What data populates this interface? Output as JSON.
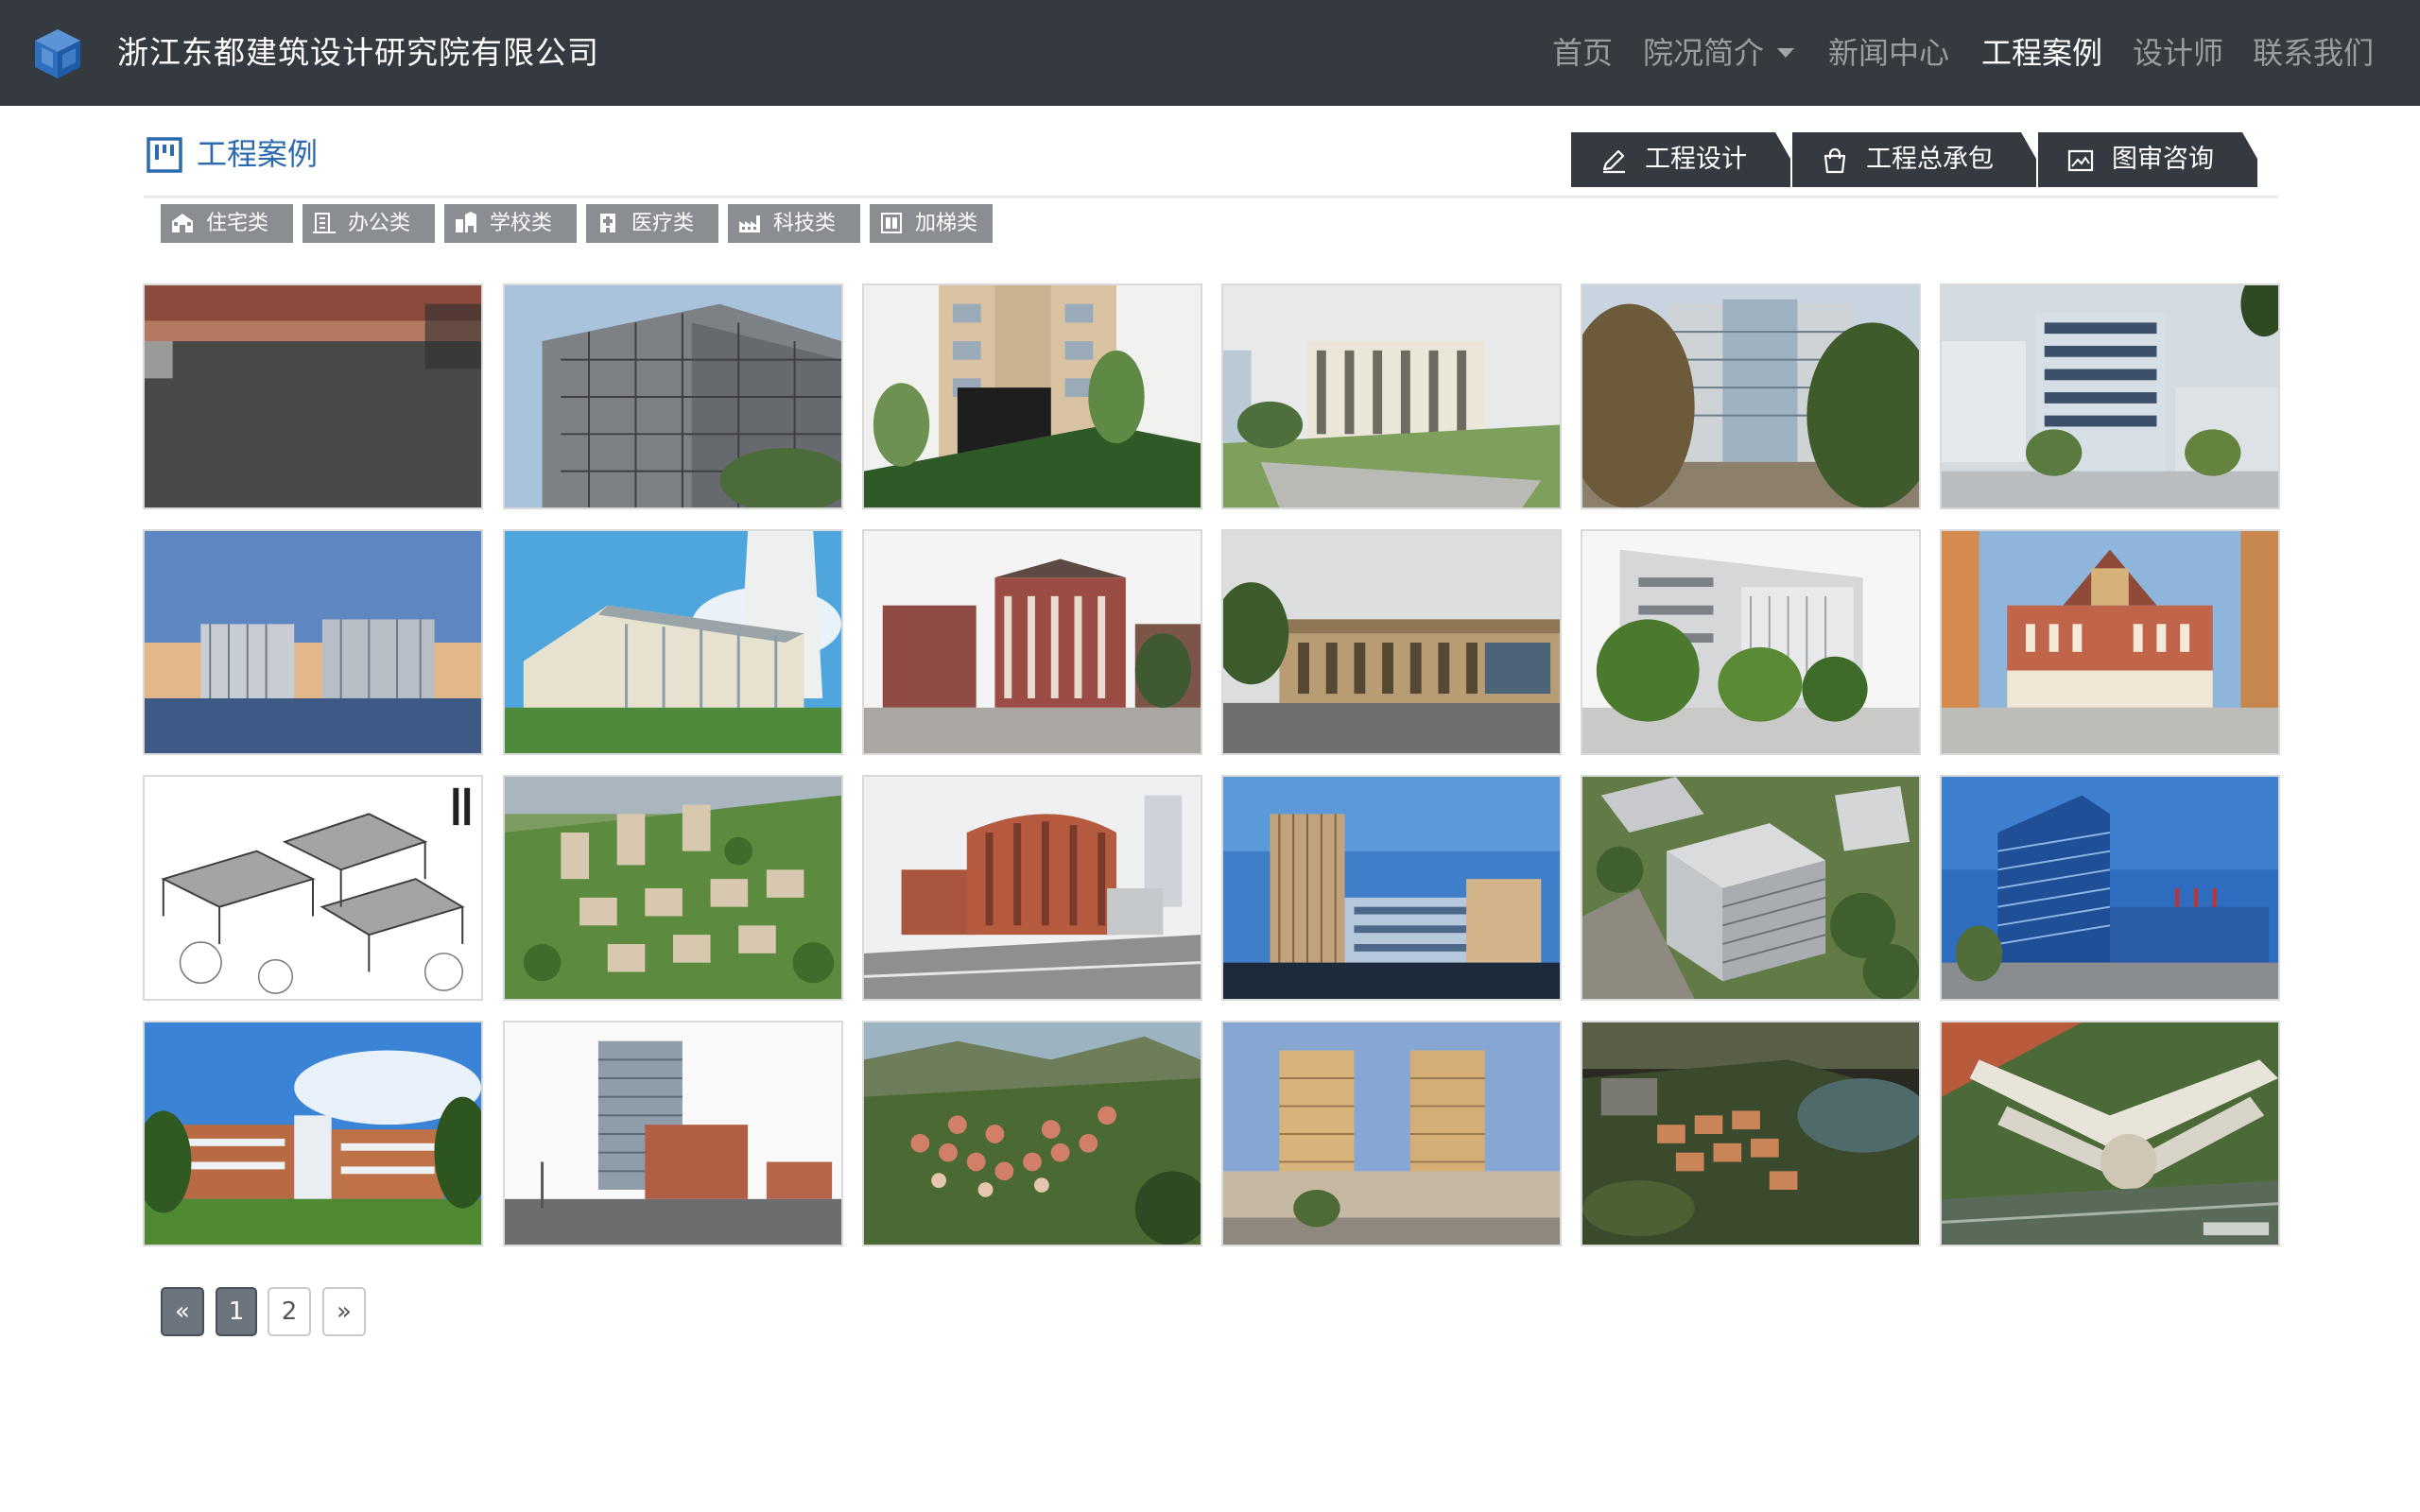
{
  "navbar": {
    "brand": "浙江东都建筑设计研究院有限公司",
    "items": [
      {
        "label": "首页",
        "active": false
      },
      {
        "label": "院况简介",
        "active": false,
        "dropdown": true
      },
      {
        "label": "新闻中心",
        "active": false
      },
      {
        "label": "工程案例",
        "active": true
      },
      {
        "label": "设计师",
        "active": false
      },
      {
        "label": "联系我们",
        "active": false
      }
    ]
  },
  "section": {
    "title": "工程案例"
  },
  "service_tabs": [
    {
      "label": "工程设计",
      "icon": "pencil-icon"
    },
    {
      "label": "工程总承包",
      "icon": "bag-icon"
    },
    {
      "label": "图审咨询",
      "icon": "image-icon"
    }
  ],
  "categories": [
    {
      "label": "住宅类",
      "icon": "house-icon"
    },
    {
      "label": "办公类",
      "icon": "building-icon"
    },
    {
      "label": "学校类",
      "icon": "school-icon"
    },
    {
      "label": "医疗类",
      "icon": "hospital-icon"
    },
    {
      "label": "科技类",
      "icon": "industry-icon"
    },
    {
      "label": "加梯类",
      "icon": "elevator-icon"
    }
  ],
  "gallery": {
    "rows": 4,
    "columns": 6,
    "images": [
      "project-photo",
      "project-photo",
      "project-photo",
      "project-photo",
      "project-photo",
      "project-photo",
      "project-photo",
      "project-photo",
      "project-photo",
      "project-photo",
      "project-photo",
      "project-photo",
      "project-photo",
      "project-photo",
      "project-photo",
      "project-photo",
      "project-photo",
      "project-photo",
      "project-photo",
      "project-photo",
      "project-photo",
      "project-photo",
      "project-photo",
      "project-photo"
    ]
  },
  "pagination": {
    "prev": "«",
    "pages": [
      "1",
      "2"
    ],
    "current": "1",
    "next": "»"
  },
  "colors": {
    "navbar_bg": "#343a40",
    "accent_blue": "#2a6aad",
    "category_bg": "#8a8e93",
    "pagination_active": "#6c757d"
  }
}
